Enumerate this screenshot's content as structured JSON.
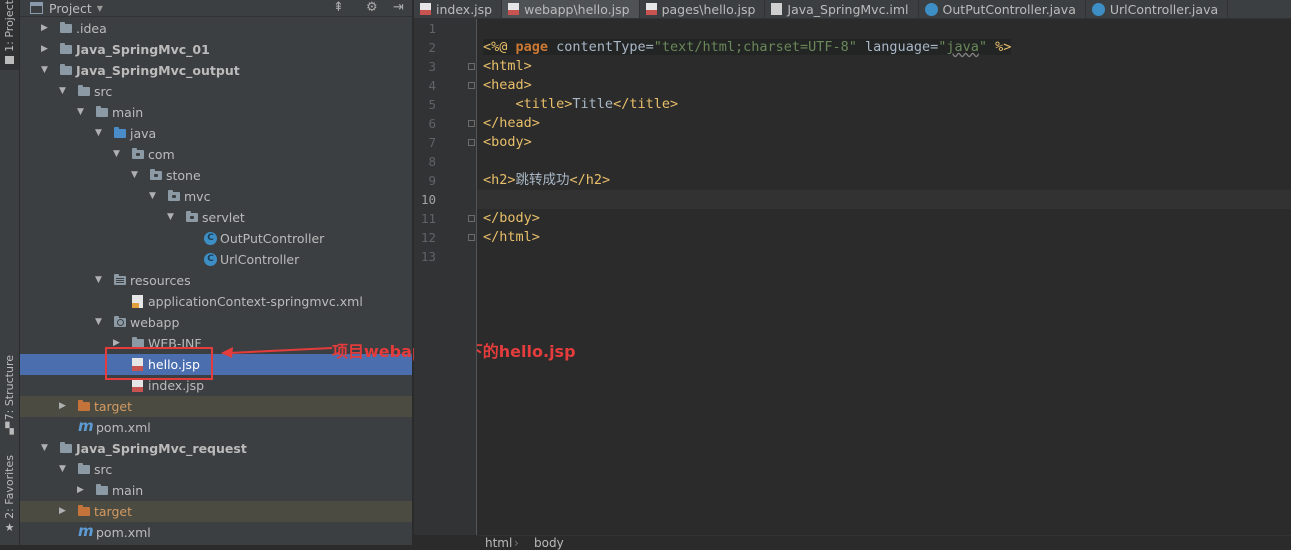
{
  "side_tabs": {
    "project": "1: Project",
    "structure": "7: Structure",
    "favorites": "2: Favorites"
  },
  "project_panel": {
    "title": "Project",
    "tree": [
      {
        "label": "idea",
        "display": ".idea",
        "type": "folder",
        "depth": 1,
        "expanded": false
      },
      {
        "label": "Java_SpringMvc_01",
        "type": "module",
        "depth": 1,
        "expanded": false
      },
      {
        "label": "Java_SpringMvc_output",
        "type": "module",
        "depth": 1,
        "expanded": true
      },
      {
        "label": "src",
        "type": "folder",
        "depth": 2,
        "expanded": true
      },
      {
        "label": "main",
        "type": "folder",
        "depth": 3,
        "expanded": true
      },
      {
        "label": "java",
        "type": "source-folder",
        "depth": 4,
        "expanded": true
      },
      {
        "label": "com",
        "type": "package",
        "depth": 5,
        "expanded": true
      },
      {
        "label": "stone",
        "type": "package",
        "depth": 6,
        "expanded": true
      },
      {
        "label": "mvc",
        "type": "package",
        "depth": 7,
        "expanded": true
      },
      {
        "label": "servlet",
        "type": "package",
        "depth": 8,
        "expanded": true
      },
      {
        "label": "OutPutController",
        "type": "class",
        "depth": 9
      },
      {
        "label": "UrlController",
        "type": "class",
        "depth": 9
      },
      {
        "label": "resources",
        "type": "resources-folder",
        "depth": 4,
        "expanded": true
      },
      {
        "label": "applicationContext-springmvc.xml",
        "type": "xml",
        "depth": 5
      },
      {
        "label": "webapp",
        "type": "web-folder",
        "depth": 4,
        "expanded": true
      },
      {
        "label": "WEB-INF",
        "type": "folder",
        "depth": 5,
        "expanded": false
      },
      {
        "label": "hello.jsp",
        "type": "jsp",
        "depth": 5,
        "selected": true
      },
      {
        "label": "index.jsp",
        "type": "jsp",
        "depth": 5
      },
      {
        "label": "target",
        "type": "excluded-folder",
        "depth": 2,
        "expanded": false
      },
      {
        "label": "pom.xml",
        "type": "maven",
        "depth": 2
      },
      {
        "label": "Java_SpringMvc_request",
        "type": "module",
        "depth": 1,
        "expanded": true
      },
      {
        "label": "src",
        "type": "folder",
        "depth": 2,
        "expanded": true
      },
      {
        "label": "main",
        "type": "folder",
        "depth": 3,
        "expanded": false
      },
      {
        "label": "target",
        "type": "excluded-folder",
        "depth": 2,
        "expanded": false
      },
      {
        "label": "pom.xml",
        "type": "maven",
        "depth": 2
      }
    ]
  },
  "annotation": {
    "text": "项目webapp路径下的hello.jsp",
    "color": "#e43c3c"
  },
  "tabs": [
    {
      "label": "index.jsp",
      "icon": "jsp-file-icon",
      "active": false
    },
    {
      "label": "webapp\\hello.jsp",
      "icon": "jsp-file-icon",
      "active": true
    },
    {
      "label": "pages\\hello.jsp",
      "icon": "jsp-file-icon",
      "active": false
    },
    {
      "label": "Java_SpringMvc.iml",
      "icon": "iml-file-icon",
      "active": false
    },
    {
      "label": "OutPutController.java",
      "icon": "class-icon",
      "active": false
    },
    {
      "label": "UrlController.java",
      "icon": "class-icon",
      "active": false
    }
  ],
  "editor": {
    "current_line": 10,
    "lines": [
      {
        "n": "1",
        "text": ""
      },
      {
        "n": "2",
        "text": "<%@ page contentType=\"text/html;charset=UTF-8\" language=\"java\" %>"
      },
      {
        "n": "3",
        "text": "<html>"
      },
      {
        "n": "4",
        "text": "<head>"
      },
      {
        "n": "5",
        "text": "    <title>Title</title>"
      },
      {
        "n": "6",
        "text": "</head>"
      },
      {
        "n": "7",
        "text": "<body>"
      },
      {
        "n": "8",
        "text": ""
      },
      {
        "n": "9",
        "text": "<h2>跳转成功</h2>"
      },
      {
        "n": "10",
        "text": ""
      },
      {
        "n": "11",
        "text": "</body>"
      },
      {
        "n": "12",
        "text": "</html>"
      },
      {
        "n": "13",
        "text": ""
      }
    ]
  },
  "breadcrumbs": [
    "html",
    "body"
  ],
  "colors": {
    "tag": "#e8bf6a",
    "keyword": "#cc7832",
    "string": "#6a8759",
    "selection": "#4b6eaf",
    "editor_bg": "#2b2b2b"
  }
}
